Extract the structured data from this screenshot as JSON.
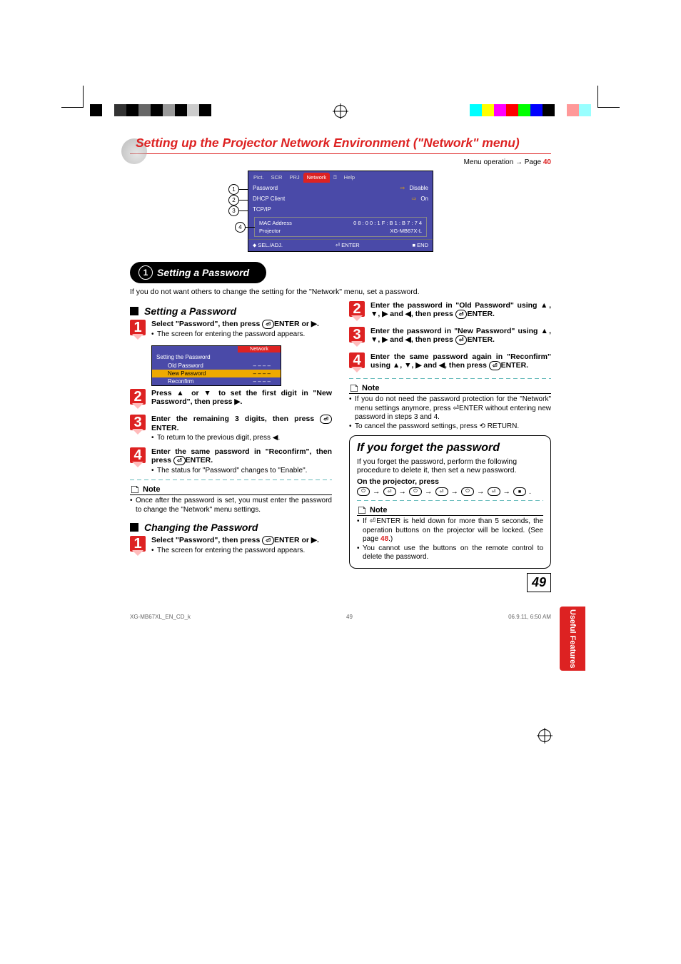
{
  "print_colors_left": [
    "#000",
    "#fff",
    "#333",
    "#000",
    "#666",
    "#000",
    "#999",
    "#000",
    "#ccc",
    "#000"
  ],
  "print_colors_right": [
    "#0ff",
    "#ff0",
    "#f0f",
    "#f00",
    "#0f0",
    "#00f",
    "#000",
    "#fff",
    "#f99",
    "#9ff"
  ],
  "main_title": "Setting up the Projector Network Environment (\"Network\" menu)",
  "menu_op_text": "Menu operation ",
  "menu_op_arrow": "→",
  "menu_op_page": " Page ",
  "menu_op_pagenum": "40",
  "osd": {
    "tabs": [
      "Pict.",
      "SCR",
      "PRJ",
      "Network",
      "⍰",
      "Help"
    ],
    "rows": [
      {
        "num": "1",
        "label": "Password",
        "arrow": true,
        "value": "Disable"
      },
      {
        "num": "2",
        "label": "DHCP Client",
        "arrow": true,
        "value": "On"
      },
      {
        "num": "3",
        "label": "TCP/IP",
        "arrow": false,
        "value": ""
      }
    ],
    "sub_num": "4",
    "mac_label": "MAC Address",
    "mac_value": "0 8 : 0 0 : 1 F : B 1 : B 7 : 7 4",
    "proj_label": "Projector",
    "proj_value": "XG-MB67X-L",
    "footer": {
      "sel": "SEL./ADJ.",
      "enter": "ENTER",
      "end": "END"
    }
  },
  "section1": {
    "pill_num": "1",
    "pill_text": "Setting a Password",
    "intro": "If you do not want others to change the setting for the \"Network\" menu, set a password.",
    "heading_a": "Setting a Password",
    "heading_b": "Changing the Password"
  },
  "left_steps_a": [
    {
      "n": "1",
      "main": "Select \"Password\", then press ",
      "icon": "enter",
      "tail": "ENTER or ▶.",
      "bullets": [
        "The screen for entering the password appears."
      ]
    },
    {
      "n": "2",
      "main": "Press ▲ or ▼ to set the first digit in \"New Password\", then press ▶."
    },
    {
      "n": "3",
      "main": "Enter the remaining 3 digits, then press ",
      "icon": "enter",
      "tail": "ENTER.",
      "bullets": [
        "To return to the previous digit, press ◀."
      ]
    },
    {
      "n": "4",
      "main": "Enter the same password in \"Reconfirm\", then press ",
      "icon": "enter",
      "tail": "ENTER.",
      "bullets": [
        "The status for \"Password\" changes to \"Enable\"."
      ]
    }
  ],
  "mini_osd": {
    "tab": "Network",
    "title": "Setting the Password",
    "rows": [
      {
        "l": "Old Password",
        "v": "– – – –",
        "hl": false
      },
      {
        "l": "New Password",
        "v": "–  – – –",
        "hl": true
      },
      {
        "l": "Reconfirm",
        "v": "– – – –",
        "hl": false
      }
    ]
  },
  "note_a": {
    "label": "Note",
    "bullets": [
      "Once after the password is set, you must enter the password to change the \"Network\" menu settings."
    ]
  },
  "left_steps_b": [
    {
      "n": "1",
      "main": "Select \"Password\", then press ",
      "icon": "enter",
      "tail": "ENTER or ▶.",
      "bullets": [
        "The screen for entering the password appears."
      ]
    }
  ],
  "right_steps": [
    {
      "n": "2",
      "main": "Enter the password in \"Old Password\" using ▲, ▼, ▶ and ◀, then press ",
      "icon": "enter",
      "tail": "ENTER."
    },
    {
      "n": "3",
      "main": "Enter the password in \"New Password\" using ▲, ▼, ▶ and ◀, then press ",
      "icon": "enter",
      "tail": "ENTER."
    },
    {
      "n": "4",
      "main": "Enter the same password again in \"Reconfirm\" using ▲, ▼, ▶ and ◀, then press ",
      "icon": "enter",
      "tail": "ENTER."
    }
  ],
  "note_b": {
    "label": "Note",
    "bullets": [
      "If you do not need the password protection for the \"Network\" menu settings anymore, press ⏎ENTER without entering new password in steps 3 and 4.",
      "To cancel the password settings, press ⟲ RETURN."
    ]
  },
  "forgot": {
    "title": "If you forget the password",
    "text": "If you forget the password, perform the following procedure to delete it, then set a new password.",
    "press_label": "On the projector, press",
    "seq": [
      "⏻",
      "⏎",
      "⏻",
      "⏎",
      "⏻",
      "⏎",
      "■"
    ]
  },
  "note_c": {
    "label": "Note",
    "bullets": [
      {
        "pre": "If ⏎ENTER is held down for more than 5 seconds, the operation buttons on the projector will be locked. (See page ",
        "link": "48",
        "post": ".)"
      },
      {
        "pre": "You cannot use the buttons on the remote control to delete the password."
      }
    ]
  },
  "side_tab": "Useful\nFeatures",
  "page_number": "49",
  "footer": {
    "l": "XG-MB67XL_EN_CD_k",
    "c": "49",
    "r": "06.9.11, 6:50 AM"
  }
}
